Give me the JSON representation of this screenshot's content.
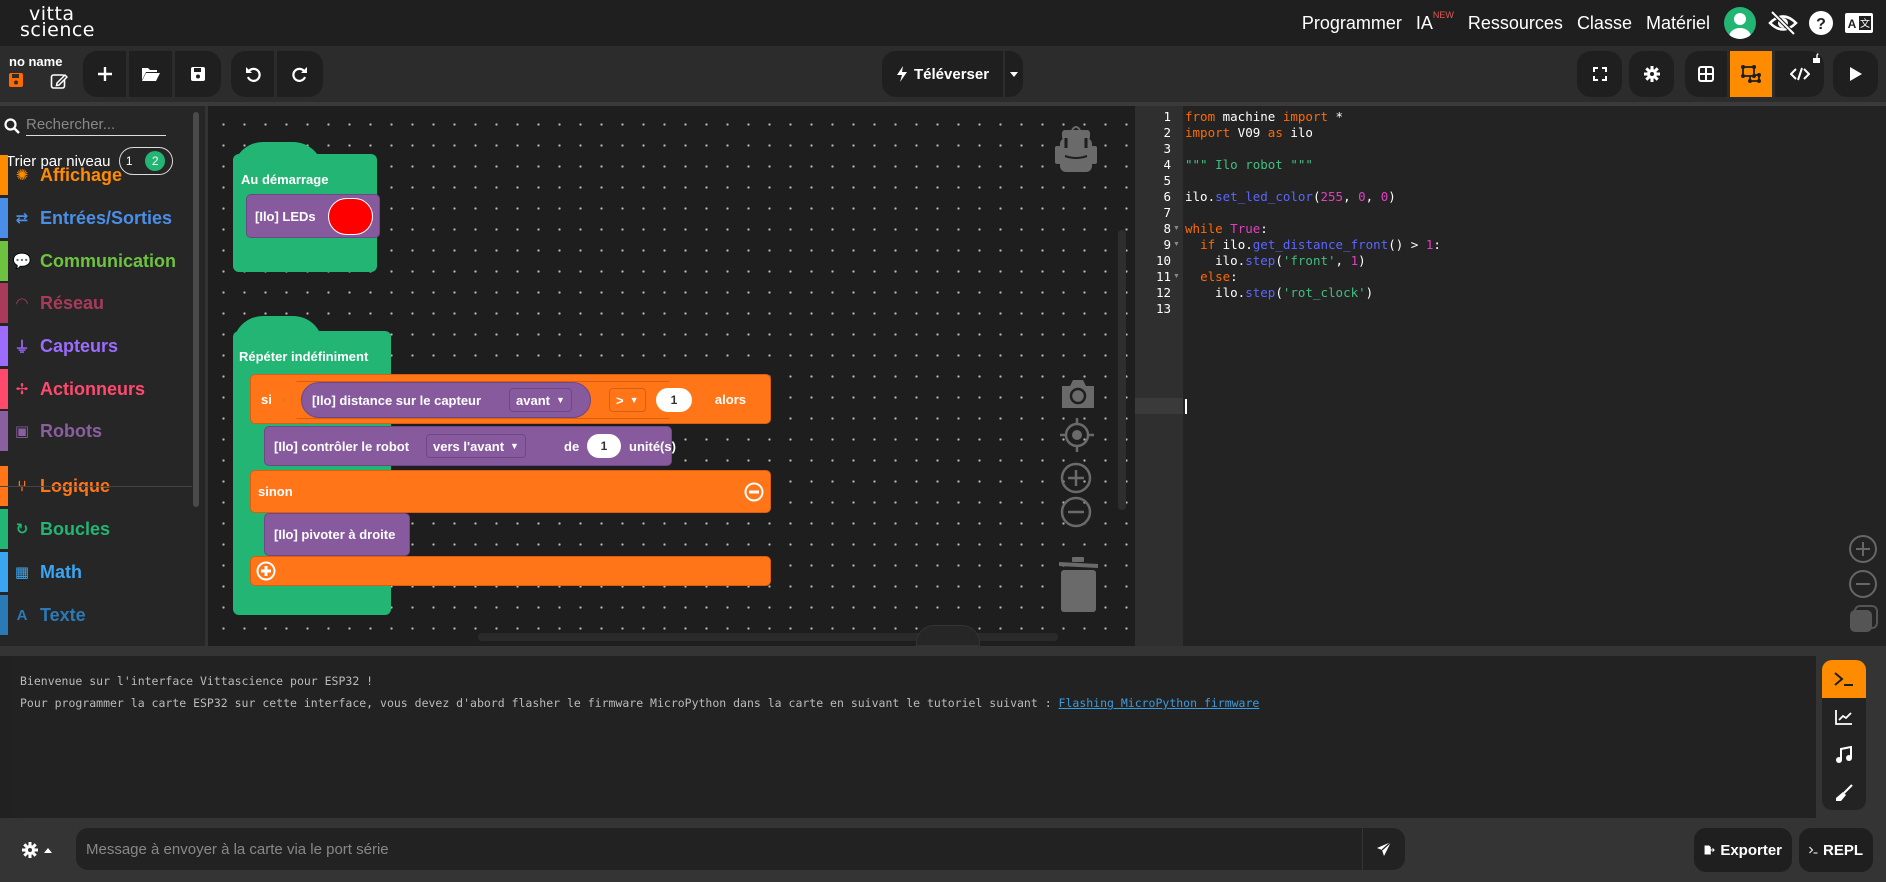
{
  "brand": {
    "line1": "vitta",
    "line2": "science"
  },
  "nav": {
    "items": [
      {
        "label": "Programmer"
      },
      {
        "label": "IA",
        "badge": "NEW"
      },
      {
        "label": "Ressources"
      },
      {
        "label": "Classe"
      },
      {
        "label": "Matériel"
      }
    ],
    "icons": [
      "user-avatar-icon",
      "hide-eye-icon",
      "help-icon",
      "translate-icon"
    ]
  },
  "project": {
    "name": "no name"
  },
  "toolbar": {
    "left_buttons": [
      "new-file",
      "open-folder",
      "save",
      "undo",
      "redo"
    ],
    "upload_label": "Téléverser",
    "right_buttons": [
      "fullscreen",
      "settings",
      "blocks-view",
      "hybrid-view",
      "code-view",
      "run"
    ],
    "active_view": "hybrid-view"
  },
  "sidebar": {
    "search_placeholder": "Rechercher...",
    "sort_label": "Trier par niveau",
    "levels": [
      "1",
      "2"
    ],
    "active_level": "2",
    "categories": [
      {
        "label": "Affichage",
        "icon": "lightbulb-icon",
        "color": "#ff8c00"
      },
      {
        "label": "Entrées/Sorties",
        "icon": "arrows-exchange-icon",
        "color": "#4a8fe7"
      },
      {
        "label": "Communication",
        "icon": "chat-icon",
        "color": "#6dc33f"
      },
      {
        "label": "Réseau",
        "icon": "wifi-icon",
        "color": "#a83a5a"
      },
      {
        "label": "Capteurs",
        "icon": "plug-icon",
        "color": "#9c6bff"
      },
      {
        "label": "Actionneurs",
        "icon": "fan-icon",
        "color": "#ff4a6e"
      },
      {
        "label": "Robots",
        "icon": "robot-icon",
        "color": "#8a5fa0"
      },
      {
        "label": "Logique",
        "icon": "branch-icon",
        "color": "#ff7518"
      },
      {
        "label": "Boucles",
        "icon": "loop-icon",
        "color": "#22b573"
      },
      {
        "label": "Math",
        "icon": "calculator-icon",
        "color": "#3aa5f0"
      },
      {
        "label": "Texte",
        "icon": "text-icon",
        "color": "#2a7ab8"
      }
    ]
  },
  "blocks": {
    "start": {
      "label": "Au démarrage",
      "leds_label": "[Ilo] LEDs",
      "led_color": "#ff0000"
    },
    "loop": {
      "label": "Répéter indéfiniment",
      "if_label": "si",
      "sensor_label": "[Ilo] distance sur le capteur",
      "sensor_dropdown": "avant",
      "operator": ">",
      "compare_value": "1",
      "then_label": "alors",
      "move_label": "[Ilo] contrôler le robot",
      "move_dropdown": "vers l'avant",
      "move_de": "de",
      "move_value": "1",
      "move_unit": "unité(s)",
      "else_label": "sinon",
      "pivot_label": "[Ilo] pivoter à droite"
    }
  },
  "code": {
    "lines": [
      [
        {
          "t": "from",
          "c": "kw"
        },
        {
          "t": " machine ",
          "c": ""
        },
        {
          "t": "import",
          "c": "kw"
        },
        {
          "t": " *",
          "c": ""
        }
      ],
      [
        {
          "t": "import",
          "c": "kw"
        },
        {
          "t": " V09 ",
          "c": ""
        },
        {
          "t": "as",
          "c": "kw"
        },
        {
          "t": " ilo",
          "c": ""
        }
      ],
      [],
      [
        {
          "t": "\"\"\" Ilo robot \"\"\"",
          "c": "str"
        }
      ],
      [],
      [
        {
          "t": "ilo.",
          "c": ""
        },
        {
          "t": "set_led_color",
          "c": "fn"
        },
        {
          "t": "(",
          "c": ""
        },
        {
          "t": "255",
          "c": "num"
        },
        {
          "t": ", ",
          "c": ""
        },
        {
          "t": "0",
          "c": "num"
        },
        {
          "t": ", ",
          "c": ""
        },
        {
          "t": "0",
          "c": "num"
        },
        {
          "t": ")",
          "c": ""
        }
      ],
      [],
      [
        {
          "t": "while",
          "c": "kw"
        },
        {
          "t": " ",
          "c": ""
        },
        {
          "t": "True",
          "c": "tr"
        },
        {
          "t": ":",
          "c": ""
        }
      ],
      [
        {
          "t": "  ",
          "c": ""
        },
        {
          "t": "if",
          "c": "kw"
        },
        {
          "t": " ilo.",
          "c": ""
        },
        {
          "t": "get_distance_front",
          "c": "fn"
        },
        {
          "t": "() > ",
          "c": ""
        },
        {
          "t": "1",
          "c": "num"
        },
        {
          "t": ":",
          "c": ""
        }
      ],
      [
        {
          "t": "    ilo.",
          "c": ""
        },
        {
          "t": "step",
          "c": "fn"
        },
        {
          "t": "(",
          "c": ""
        },
        {
          "t": "'front'",
          "c": "str"
        },
        {
          "t": ", ",
          "c": ""
        },
        {
          "t": "1",
          "c": "num"
        },
        {
          "t": ")",
          "c": ""
        }
      ],
      [
        {
          "t": "  ",
          "c": ""
        },
        {
          "t": "else",
          "c": "kw"
        },
        {
          "t": ":",
          "c": ""
        }
      ],
      [
        {
          "t": "    ilo.",
          "c": ""
        },
        {
          "t": "step",
          "c": "fn"
        },
        {
          "t": "(",
          "c": ""
        },
        {
          "t": "'rot_clock'",
          "c": "str"
        },
        {
          "t": ")",
          "c": ""
        }
      ],
      []
    ],
    "foldable_lines": [
      8,
      9,
      11
    ],
    "current_line": 13
  },
  "console": {
    "line1": "Bienvenue sur l'interface Vittascience pour ESP32 !",
    "line2": "Pour programmer la carte ESP32 sur cette interface, vous devez d'abord flasher le firmware MicroPython dans la carte en suivant le tutoriel suivant : ",
    "link": "Flashing MicroPython firmware",
    "tabs": [
      "terminal",
      "plotter",
      "music",
      "clear"
    ],
    "active_tab": "terminal"
  },
  "bottom": {
    "message_placeholder": "Message à envoyer à la carte via le port série",
    "export_label": "Exporter",
    "repl_label": "REPL"
  }
}
